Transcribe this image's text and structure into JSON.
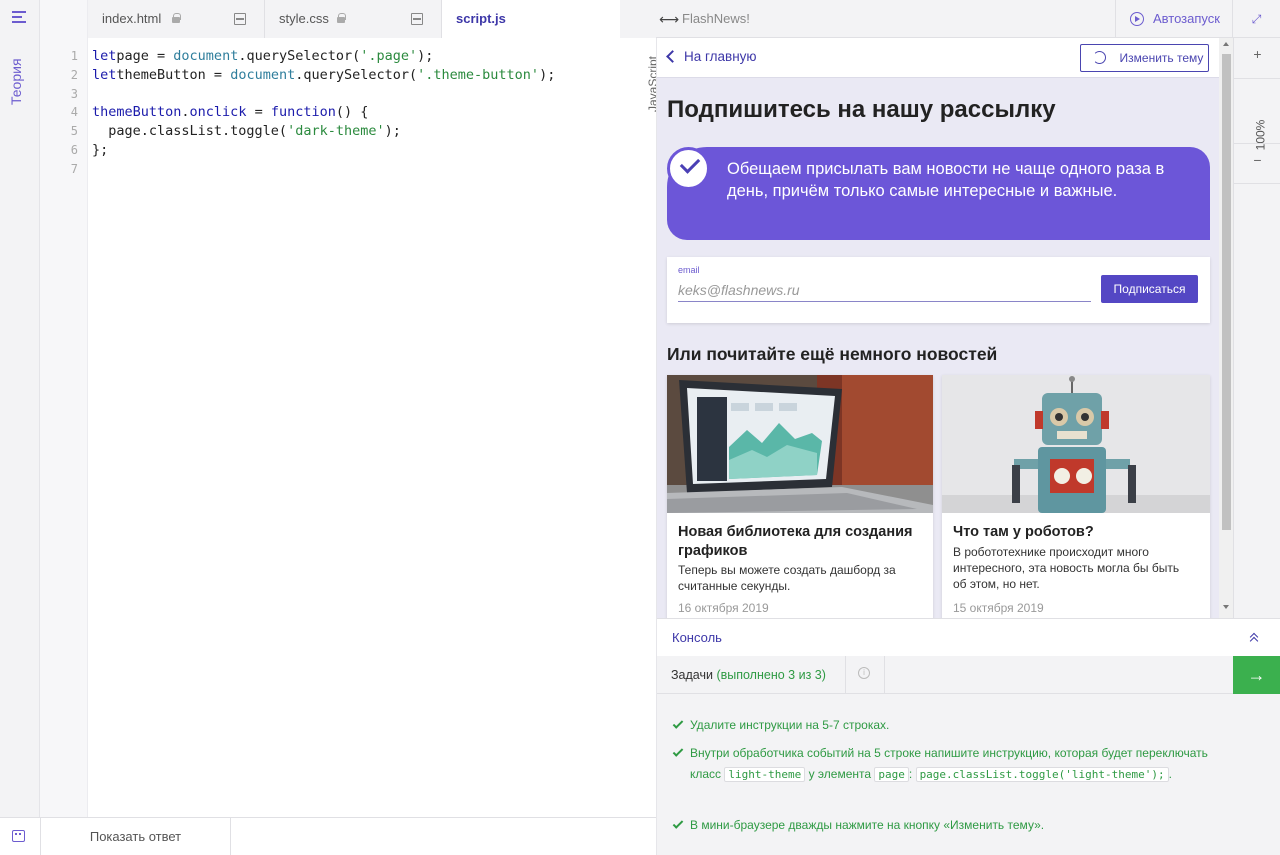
{
  "rail": {
    "menu_icon": "menu-icon",
    "theory_label": "Теория"
  },
  "tabs": [
    {
      "label": "index.html",
      "locked": true
    },
    {
      "label": "style.css",
      "locked": true
    },
    {
      "label": "script.js",
      "active": true
    }
  ],
  "editor": {
    "language_label": "JavaScript",
    "line_numbers": [
      "1",
      "2",
      "3",
      "4",
      "5",
      "6",
      "7"
    ],
    "lines": [
      {
        "parts": [
          [
            "kw",
            "let"
          ],
          [
            "",
            "page = "
          ],
          [
            "obj",
            "document"
          ],
          [
            "",
            ".querySelector("
          ],
          [
            "str",
            "'.page'"
          ],
          [
            "",
            ");"
          ]
        ]
      },
      {
        "parts": [
          [
            "kw",
            "let"
          ],
          [
            "",
            "themeButton = "
          ],
          [
            "obj",
            "document"
          ],
          [
            "",
            ".querySelector("
          ],
          [
            "str",
            "'.theme-button'"
          ],
          [
            "",
            ");"
          ]
        ]
      },
      {
        "parts": []
      },
      {
        "parts": [
          [
            "kw",
            "themeButton"
          ],
          [
            "",
            "."
          ],
          [
            "kw",
            "onclick"
          ],
          [
            "",
            " = "
          ],
          [
            "kw",
            "function"
          ],
          [
            "",
            "() {"
          ]
        ]
      },
      {
        "parts": [
          [
            "",
            "  page.classList.toggle("
          ],
          [
            "str",
            "'dark-theme'"
          ],
          [
            "",
            ");"
          ]
        ]
      },
      {
        "parts": [
          [
            "",
            "};"
          ]
        ]
      },
      {
        "parts": []
      }
    ]
  },
  "bottom": {
    "show_answer": "Показать ответ"
  },
  "browser": {
    "title": "FlashNews!",
    "autorun": "Автозапуск",
    "zoom": "100%",
    "zoom_in": "+",
    "zoom_out": "−",
    "back_label": "На главную",
    "theme_button": "Изменить тему",
    "heading": "Подпишитесь на нашу рассылку",
    "promise_text": "Обещаем присылать вам новости не чаще одного раза в день, причём только самые интересные и важные.",
    "email_label": "email",
    "email_placeholder": "keks@flashnews.ru",
    "subscribe": "Подписаться",
    "news_heading": "Или почитайте ещё немного новостей",
    "cards": [
      {
        "title": "Новая библиотека для создания графиков",
        "text": "Теперь вы можете создать дашборд за считанные секунды.",
        "date": "16 октября 2019"
      },
      {
        "title": "Что там у роботов?",
        "text": "В робототехнике происходит много интересного, эта новость могла бы быть об этом, но нет.",
        "date": "15 октября 2019"
      }
    ]
  },
  "console": {
    "label": "Консоль"
  },
  "tasks": {
    "label": "Задачи",
    "status": "(выполнено 3 из 3)",
    "items": [
      {
        "segments": [
          [
            "t",
            "Удалите инструкции на 5-7 строках."
          ]
        ]
      },
      {
        "segments": [
          [
            "t",
            "Внутри обработчика событий на 5 строке напишите инструкцию, которая будет переключать класс "
          ],
          [
            "c",
            "light-theme"
          ],
          [
            "t",
            " у элемента "
          ],
          [
            "c",
            "page"
          ],
          [
            "t",
            ": "
          ],
          [
            "c",
            "page.classList.toggle('light-theme');"
          ],
          [
            "t",
            "."
          ]
        ]
      },
      {
        "segments": [
          [
            "t",
            "В мини-браузере дважды нажмите на кнопку «Изменить тему»."
          ]
        ]
      }
    ]
  },
  "colors": {
    "accent": "#6c5ccf",
    "promise_bg": "#6c56d8",
    "success": "#2e9a43",
    "next_button": "#3bb04e"
  }
}
